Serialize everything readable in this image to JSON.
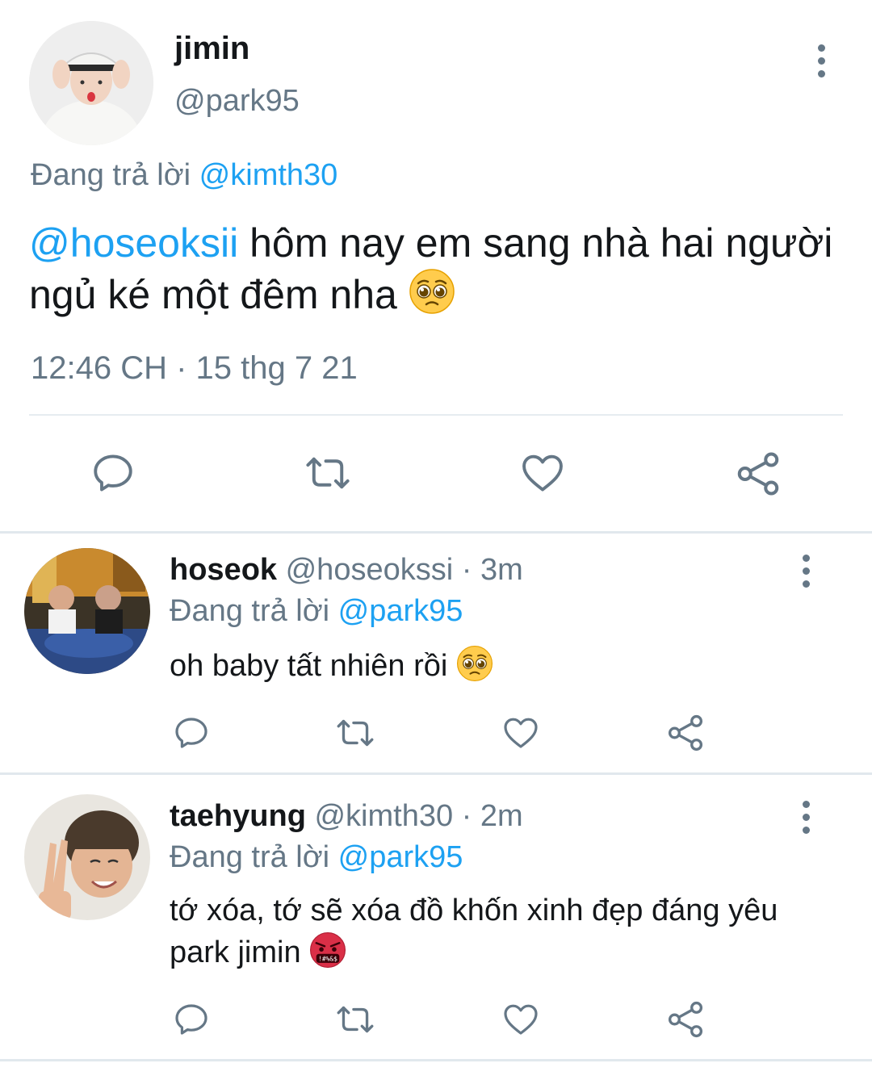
{
  "main_tweet": {
    "name": "jimin",
    "handle": "@park95",
    "replying_label": "Đang trả lời",
    "replying_to": "@kimth30",
    "mention": "@hoseoksii",
    "text": " hôm nay em sang nhà hai người ngủ ké một đêm nha ",
    "emoji": "pleading-face",
    "timestamp": "12:46 CH · 15 thg 7 21"
  },
  "replies": [
    {
      "name": "hoseok",
      "handle": "@hoseokssi",
      "time": " · 3m",
      "replying_label": "Đang trả lời",
      "replying_to": "@park95",
      "text": "oh baby tất nhiên rồi ",
      "emoji": "pleading-face"
    },
    {
      "name": "taehyung",
      "handle": "@kimth30",
      "time": " · 2m",
      "replying_label": "Đang trả lời",
      "replying_to": "@park95",
      "text": "tớ xóa, tớ sẽ xóa đồ khốn xinh đẹp đáng yêu park jimin ",
      "emoji": "face-with-symbols-on-mouth"
    }
  ],
  "colors": {
    "text": "#14171a",
    "secondary": "#657786",
    "link": "#1da1f2",
    "divider": "#e6ecf0"
  }
}
